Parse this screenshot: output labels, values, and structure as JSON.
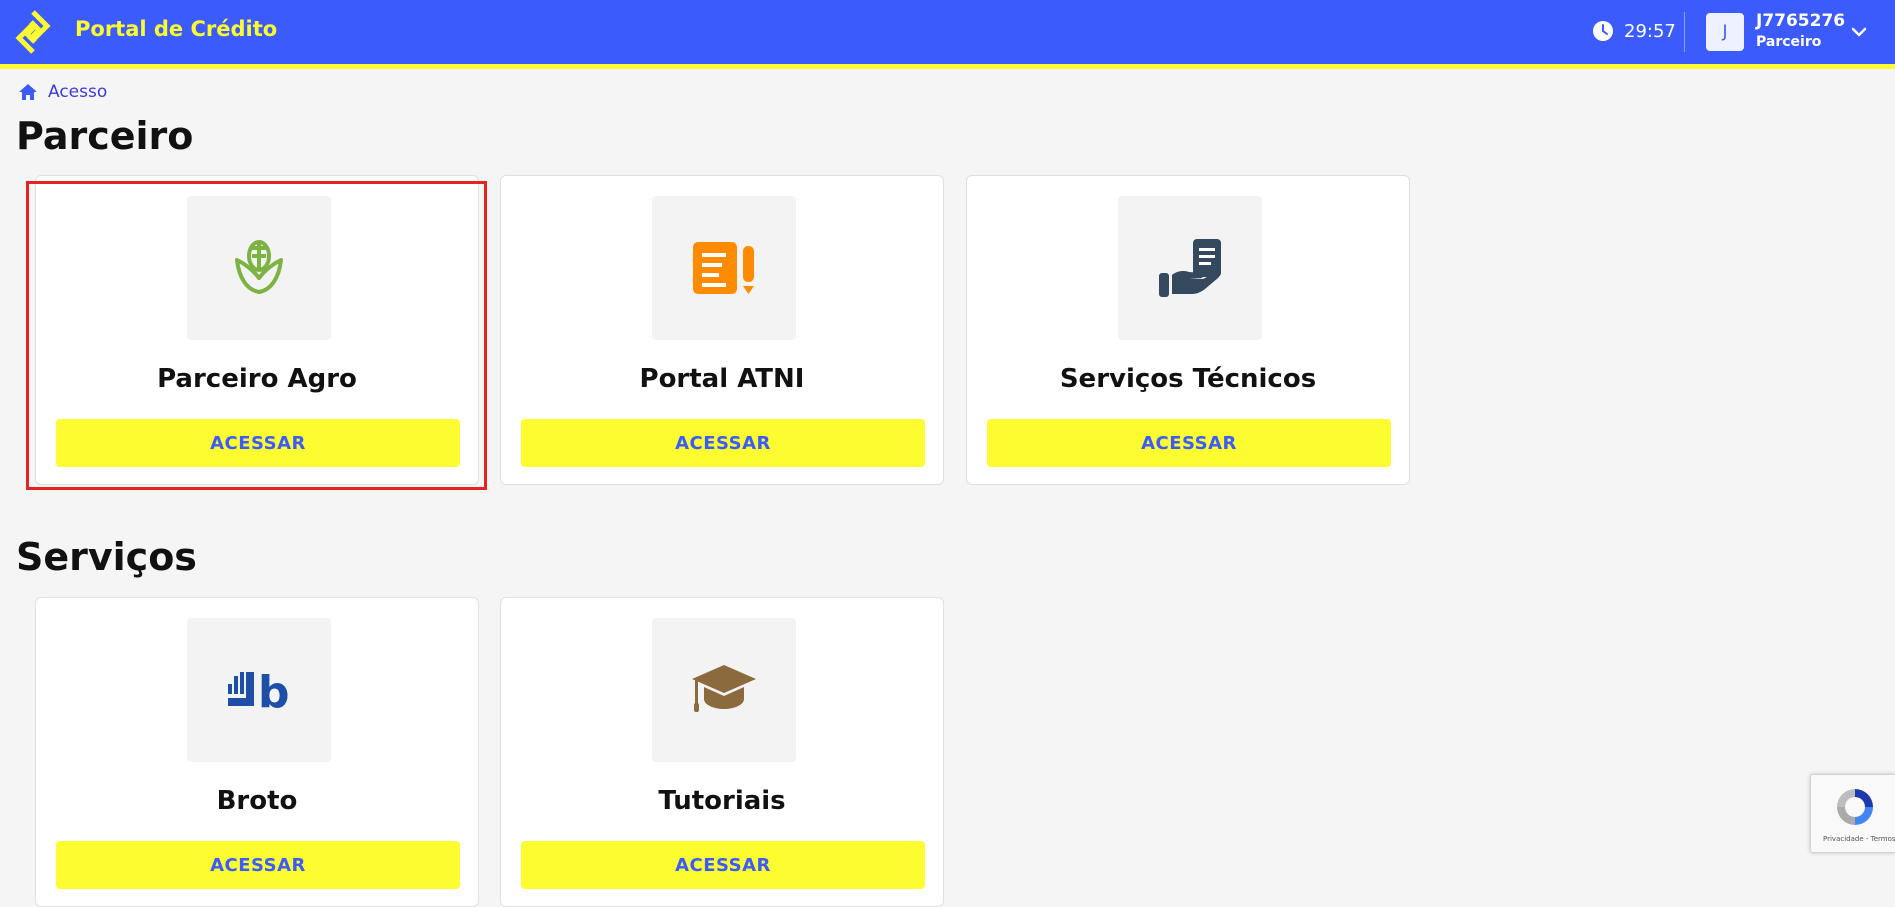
{
  "header": {
    "app_title": "Portal de Crédito",
    "timer": "29:57",
    "avatar_initial": "J",
    "user_id": "J7765276",
    "user_role": "Parceiro",
    "logo_icon": "bb-logo-icon",
    "clock_icon": "clock-icon",
    "dropdown_icon": "chevron-down-icon"
  },
  "breadcrumb": {
    "label": "Acesso",
    "icon": "home-icon"
  },
  "sections": [
    {
      "title": "Parceiro",
      "cards": [
        {
          "title": "Parceiro Agro",
          "button": "ACESSAR",
          "icon": "corn-icon"
        },
        {
          "title": "Portal ATNI",
          "button": "ACESSAR",
          "icon": "document-pencil-icon"
        },
        {
          "title": "Serviços Técnicos",
          "button": "ACESSAR",
          "icon": "hand-document-icon"
        }
      ]
    },
    {
      "title": "Serviços",
      "cards": [
        {
          "title": "Broto",
          "button": "ACESSAR",
          "icon": "broto-logo-icon"
        },
        {
          "title": "Tutoriais",
          "button": "ACESSAR",
          "icon": "graduation-cap-icon"
        }
      ]
    }
  ],
  "recaptcha": {
    "links": "Privacidade - Termos"
  },
  "colors": {
    "header_bg": "#3b5bfd",
    "accent_yellow": "#fcfc30",
    "highlight_red": "#e52321",
    "agro_green": "#7cb342",
    "atni_orange": "#ff8c00",
    "services_navy": "#34495e",
    "broto_blue": "#1e4fa8",
    "tutorial_brown": "#8b6a3e"
  }
}
